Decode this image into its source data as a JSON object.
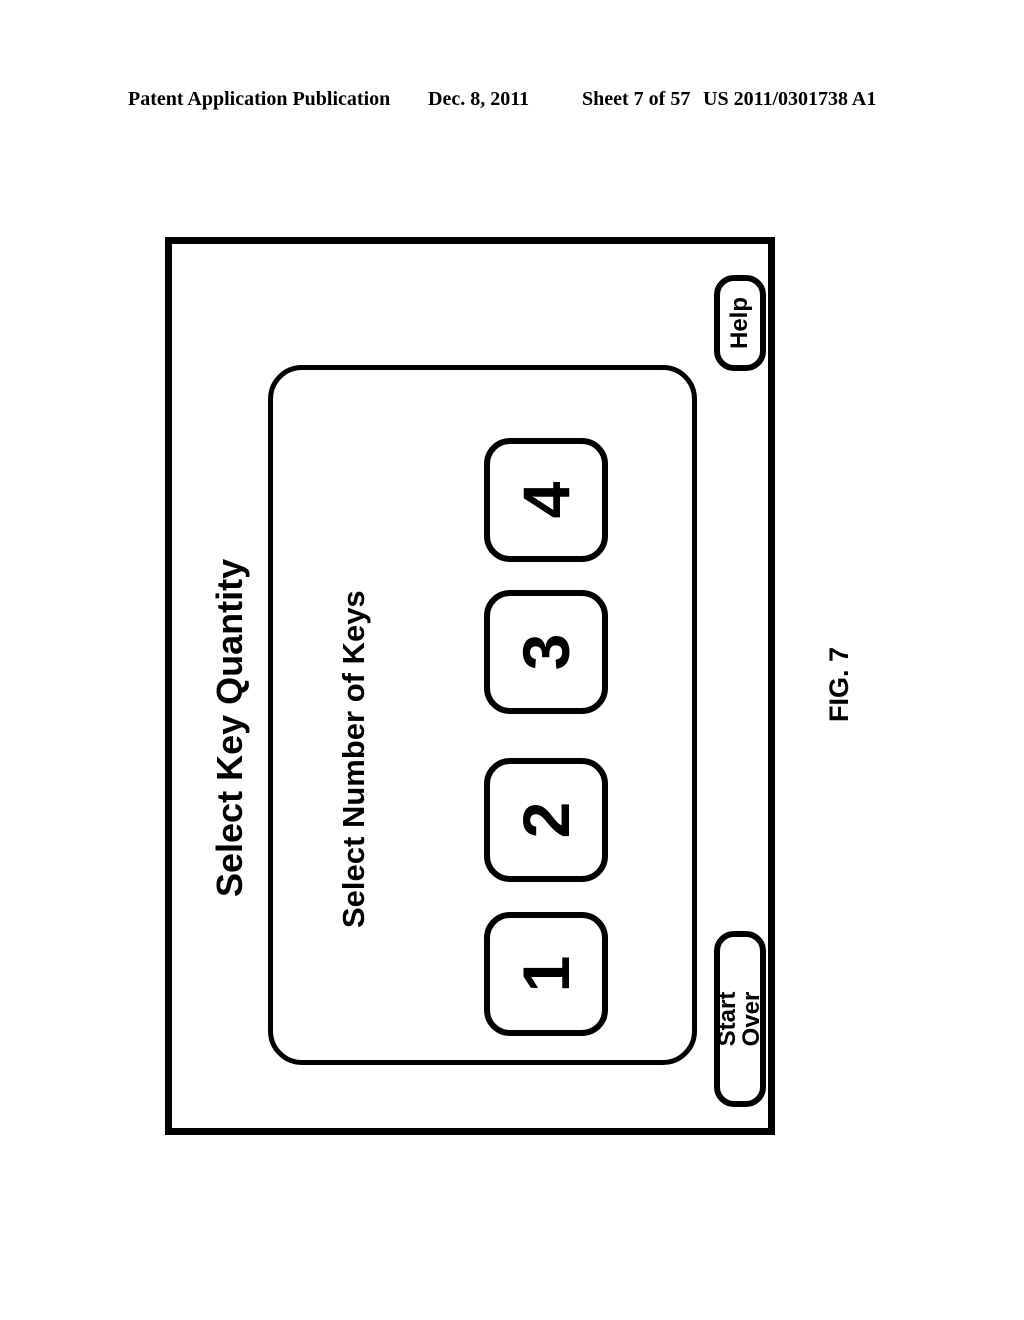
{
  "document_header": {
    "publication_label": "Patent Application Publication",
    "date": "Dec. 8, 2011",
    "sheet": "Sheet 7 of 57",
    "document_number": "US 2011/0301738 A1"
  },
  "figure": {
    "caption": "FIG. 7",
    "orientation_note": "screen content rotated 90 degrees counter-clockwise on the page"
  },
  "screen": {
    "title": "Select Key Quantity",
    "panel": {
      "subtitle": "Select Number of Keys",
      "keypad": {
        "options": [
          {
            "label": "1",
            "value": 1
          },
          {
            "label": "2",
            "value": 2
          },
          {
            "label": "3",
            "value": 3
          },
          {
            "label": "4",
            "value": 4
          }
        ]
      }
    },
    "actions": {
      "help_label": "Help",
      "start_over_label": "Start Over"
    }
  },
  "colors": {
    "stroke": "#000000",
    "background": "#ffffff"
  }
}
